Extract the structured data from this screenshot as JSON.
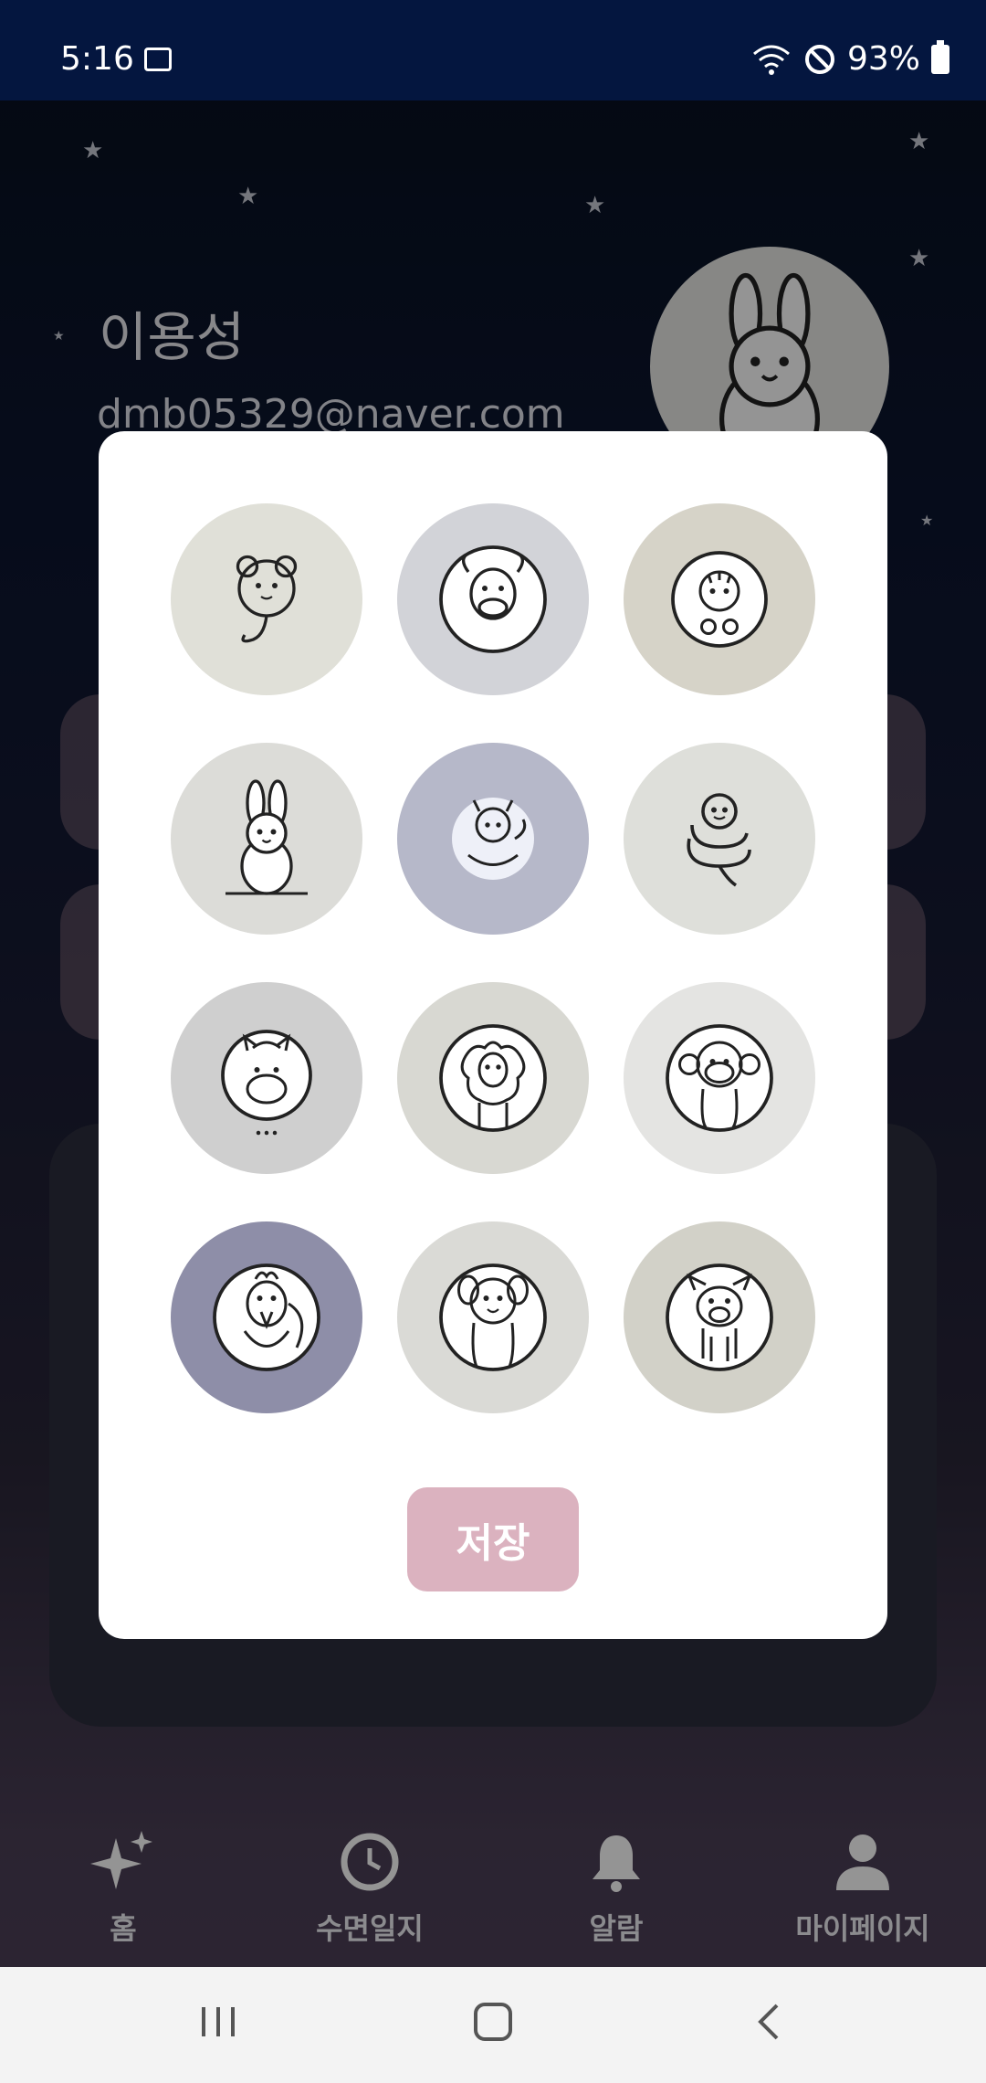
{
  "status_bar": {
    "time": "5:16",
    "battery": "93%"
  },
  "profile": {
    "name": "이용성",
    "email": "dmb05329@naver.com"
  },
  "avatar_picker": {
    "options": [
      {
        "name": "rat",
        "bg": "#e0e0d8"
      },
      {
        "name": "ox",
        "bg": "#d2d3d8"
      },
      {
        "name": "tiger",
        "bg": "#d6d3c8"
      },
      {
        "name": "rabbit",
        "bg": "#dcdcd8"
      },
      {
        "name": "dragon",
        "bg": "#b6b8c9"
      },
      {
        "name": "snake",
        "bg": "#dedfda"
      },
      {
        "name": "horse",
        "bg": "#cfcfcf"
      },
      {
        "name": "sheep",
        "bg": "#d8d8d2"
      },
      {
        "name": "monkey",
        "bg": "#e4e4e2"
      },
      {
        "name": "rooster",
        "bg": "#8e8ea8"
      },
      {
        "name": "dog",
        "bg": "#dadad6"
      },
      {
        "name": "pig",
        "bg": "#d2d1c8"
      }
    ],
    "save_label": "저장"
  },
  "bottom_nav": {
    "items": [
      {
        "label": "홈",
        "icon": "sparkles-icon"
      },
      {
        "label": "수면일지",
        "icon": "clock-icon"
      },
      {
        "label": "알람",
        "icon": "bell-icon"
      },
      {
        "label": "마이페이지",
        "icon": "person-icon"
      }
    ]
  },
  "colors": {
    "accent": "#dbb2bf",
    "status_bar": "#04163f"
  }
}
